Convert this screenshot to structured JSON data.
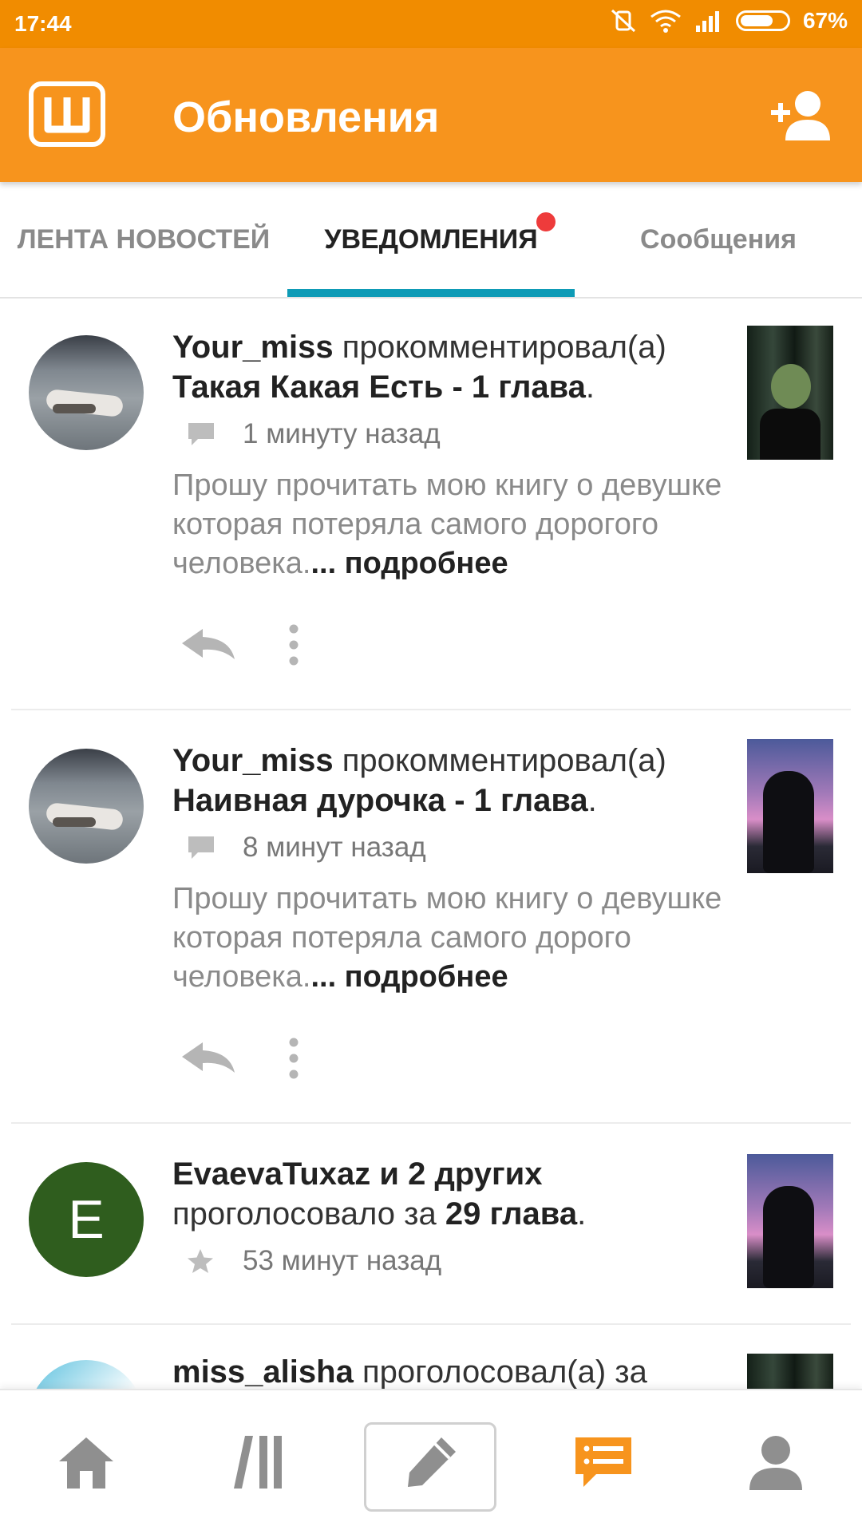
{
  "status_bar": {
    "time": "17:44",
    "battery": "67%",
    "icons": [
      "vibrate-off-icon",
      "wifi-icon",
      "signal-icon",
      "battery-icon"
    ]
  },
  "app_bar": {
    "logo_letter": "Ш",
    "title": "Обновления",
    "action_icon": "add-user-icon"
  },
  "tabs": [
    {
      "label": "ЛЕНТА НОВОСТЕЙ",
      "active": false
    },
    {
      "label": "УВЕДОМЛЕНИЯ",
      "active": true,
      "has_badge": true
    },
    {
      "label": "Сообщения",
      "active": false
    }
  ],
  "notifications": [
    {
      "user": "Your_miss",
      "action": "прокомментировал(а)",
      "target": "Такая Какая Есть - 1 глава",
      "end": ".",
      "type_icon": "comment-icon",
      "time": "1 минуту назад",
      "text": "Прошу прочитать мою книгу о девушке которая потеряла самого дорогого человека.",
      "more": "... подробнее"
    },
    {
      "user": "Your_miss",
      "action": "прокомментировал(а)",
      "target": "Наивная дурочка - 1 глава",
      "end": ".",
      "type_icon": "comment-icon",
      "time": "8 минут назад",
      "text": "Прошу прочитать мою книгу о девушке которая потеряла самого дорого человека.",
      "more": "... подробнее"
    },
    {
      "user": "EvaevaTuxaz и 2 других",
      "action": "проголосовало за",
      "target": "29 глава",
      "end": ".",
      "avatar_letter": "E",
      "type_icon": "star-icon",
      "time": "53 минут назад"
    },
    {
      "user": "miss_alisha",
      "action": "проголосовал(а) за"
    }
  ],
  "bottom_nav": [
    "home-icon",
    "library-icon",
    "write-icon",
    "updates-icon",
    "profile-icon"
  ],
  "colors": {
    "status_bar": "#f18c00",
    "app_bar": "#f7941d",
    "tab_indicator": "#0e9bb6",
    "badge": "#ee3b3b",
    "nav_active": "#f7941d"
  }
}
